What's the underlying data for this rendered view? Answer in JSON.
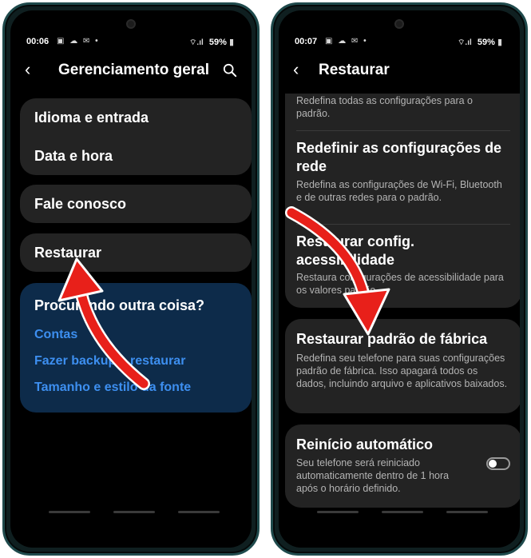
{
  "left_phone": {
    "status": {
      "time": "00:06",
      "notif_icons": "▣ ☁ ✉ •",
      "signal": "⌔.ıl",
      "battery": "59%"
    },
    "header": {
      "title": "Gerenciamento geral"
    },
    "groups": [
      {
        "items": [
          "Idioma e entrada",
          "Data e hora"
        ]
      },
      {
        "items": [
          "Fale conosco"
        ]
      },
      {
        "items": [
          "Restaurar"
        ]
      }
    ],
    "suggestions": {
      "title": "Procurando outra coisa?",
      "links": [
        "Contas",
        "Fazer backup e restaurar",
        "Tamanho e estilo da fonte"
      ]
    }
  },
  "right_phone": {
    "status": {
      "time": "00:07",
      "notif_icons": "▣ ☁ ✉ •",
      "signal": "⌔.ıl",
      "battery": "59%"
    },
    "header": {
      "title": "Restaurar"
    },
    "cropped_desc": "Redefina todas as configurações para o padrão.",
    "items": [
      {
        "title": "Redefinir as configurações de rede",
        "desc": "Redefina as configurações de Wi-Fi, Bluetooth e de outras redes para o padrão."
      },
      {
        "title": "Restaurar config. acessibilidade",
        "desc": "Restaura configurações de acessibilidade para os valores padrão."
      },
      {
        "title": "Restaurar padrão de fábrica",
        "desc": "Redefina seu telefone para suas configurações padrão de fábrica. Isso apagará todos os dados, incluindo arquivo e aplicativos baixados."
      },
      {
        "title": "Reinício automático",
        "desc": "Seu telefone será reiniciado automaticamente dentro de 1 hora após o horário definido.",
        "toggle_on": false
      }
    ]
  },
  "colors": {
    "accent_link": "#3d8ff0",
    "arrow": "#e8201a",
    "card": "#232323",
    "suggest_bg": "#0d2b4a"
  }
}
